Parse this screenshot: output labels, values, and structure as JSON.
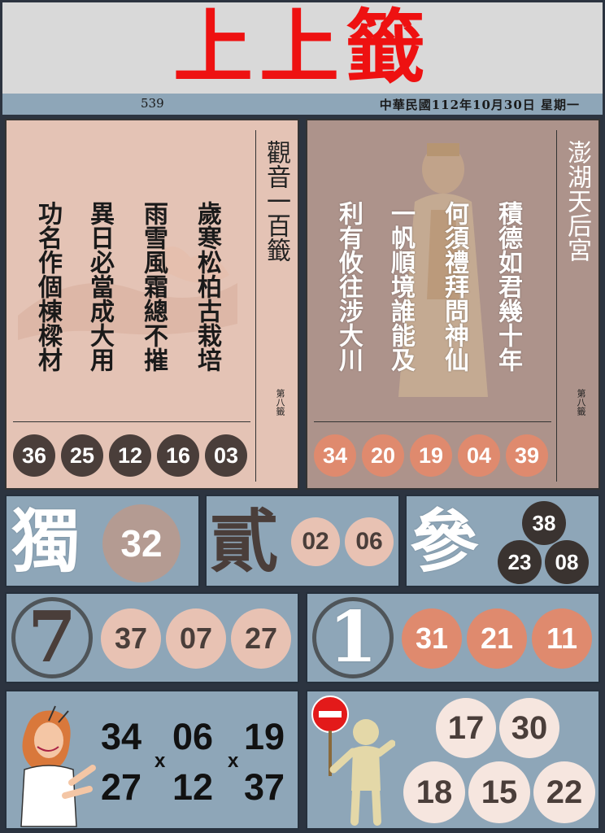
{
  "header": {
    "title": "上上籤"
  },
  "subbar": {
    "lottery": "539",
    "date": "中華民國112年10月30日 星期一"
  },
  "poem_left": {
    "columns": [
      "歲寒松柏古栽培",
      "雨雪風霜總不摧",
      "異日必當成大用",
      "功名作個棟樑材"
    ],
    "temple": "觀音一百籤",
    "number": "第八籤",
    "balls": [
      "36",
      "25",
      "12",
      "16",
      "03"
    ]
  },
  "poem_right": {
    "columns": [
      "積德如君幾十年",
      "何須禮拜問神仙",
      "一帆順境誰能及",
      "利有攸往涉大川"
    ],
    "temple": "澎湖天后宮",
    "number": "第八籤",
    "balls": [
      "34",
      "20",
      "19",
      "04",
      "39"
    ]
  },
  "du": {
    "label": "獨",
    "numbers": [
      "32"
    ]
  },
  "er": {
    "label": "貳",
    "numbers": [
      "02",
      "06"
    ]
  },
  "san": {
    "label": "參",
    "numbers": [
      "38",
      "23",
      "08"
    ]
  },
  "tail_seven": {
    "digit": "7",
    "numbers": [
      "37",
      "07",
      "27"
    ]
  },
  "tail_one": {
    "digit": "1",
    "numbers": [
      "31",
      "21",
      "11"
    ]
  },
  "combo": {
    "row1": [
      "34",
      "06",
      "19"
    ],
    "row2": [
      "27",
      "12",
      "37"
    ],
    "sep": "x"
  },
  "avoid": {
    "numbers": [
      "17",
      "30",
      "18",
      "15",
      "22"
    ]
  },
  "colors": {
    "title": "#ee1111",
    "panel_blue": "#8ea6b8",
    "dark_ball": "#4a3e3a",
    "orange_ball": "#df8a6e",
    "pink_ball": "#e8c2b3",
    "light_ball": "#f6e6df"
  },
  "icons": [
    "woman-pointing-illustration",
    "no-entry-sign-figure",
    "goddess-figure",
    "brush-ring"
  ]
}
